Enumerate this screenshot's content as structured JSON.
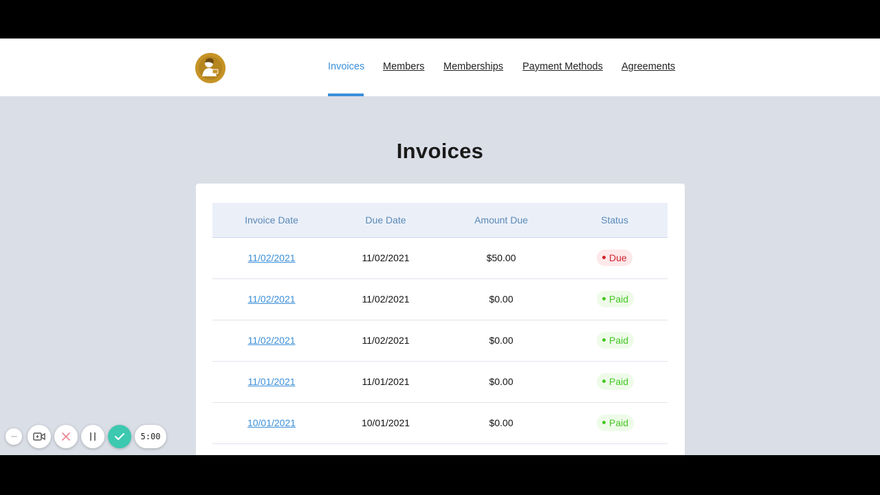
{
  "nav": {
    "links": [
      {
        "label": "Invoices",
        "active": true
      },
      {
        "label": "Members",
        "active": false
      },
      {
        "label": "Memberships",
        "active": false
      },
      {
        "label": "Payment Methods",
        "active": false
      },
      {
        "label": "Agreements",
        "active": false
      }
    ]
  },
  "page": {
    "title": "Invoices"
  },
  "table": {
    "headers": [
      "Invoice Date",
      "Due Date",
      "Amount Due",
      "Status"
    ],
    "rows": [
      {
        "invoice_date": "11/02/2021",
        "due_date": "11/02/2021",
        "amount": "$50.00",
        "status": "Due"
      },
      {
        "invoice_date": "11/02/2021",
        "due_date": "11/02/2021",
        "amount": "$0.00",
        "status": "Paid"
      },
      {
        "invoice_date": "11/02/2021",
        "due_date": "11/02/2021",
        "amount": "$0.00",
        "status": "Paid"
      },
      {
        "invoice_date": "11/01/2021",
        "due_date": "11/01/2021",
        "amount": "$0.00",
        "status": "Paid"
      },
      {
        "invoice_date": "10/01/2021",
        "due_date": "10/01/2021",
        "amount": "$0.00",
        "status": "Paid"
      }
    ]
  },
  "recorder": {
    "more_label": "···",
    "timer": "5:00"
  },
  "colors": {
    "accent": "#3a8fd9",
    "due": "#d0242e",
    "paid": "#43c722",
    "confirm": "#3dc8b0"
  }
}
